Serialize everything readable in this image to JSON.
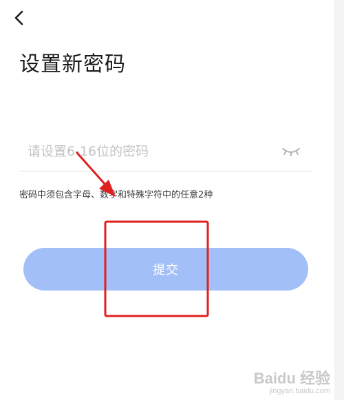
{
  "header": {
    "back_icon": "chevron-left-icon",
    "title": "设置新密码"
  },
  "password_field": {
    "placeholder": "请设置6-16位的密码",
    "value": "",
    "visibility_icon": "eye-closed-icon"
  },
  "hint": "密码中须包含字母、数字和特殊字符中的任意2种",
  "submit": {
    "label": "提交",
    "color": "#a3bff7"
  },
  "annotations": {
    "arrow_color": "#e0201f",
    "box_color": "#e0201f"
  },
  "watermark": {
    "logo": "Baidu 经验",
    "url": "jingyan.baidu.com"
  }
}
